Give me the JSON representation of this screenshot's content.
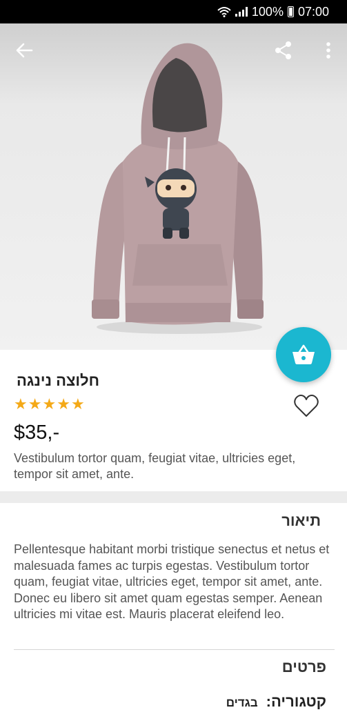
{
  "status": {
    "battery": "100%",
    "time": "07:00"
  },
  "appbar": {
    "back_icon": "arrow-back-icon",
    "share_icon": "share-icon",
    "more_icon": "more-vert-icon"
  },
  "product": {
    "title": "חלוצה נינגה",
    "rating": 5,
    "rating_max": 5,
    "price": "$35,-",
    "short_description": "Vestibulum tortor quam, feugiat vitae, ultricies eget, tempor sit amet, ante."
  },
  "description": {
    "heading": "תיאור",
    "body": "Pellentesque habitant morbi tristique senectus et netus et malesuada fames ac turpis egestas. Vestibulum tortor quam, feugiat vitae, ultricies eget, tempor sit amet, ante. Donec eu libero sit amet quam egestas semper. Aenean ultricies mi vitae est. Mauris placerat eleifend leo."
  },
  "details": {
    "heading": "פרטים",
    "category_label": "קטגוריה:",
    "category_value": "בגדים"
  },
  "colors": {
    "accent": "#1bb7d0",
    "star": "#f4a917"
  }
}
